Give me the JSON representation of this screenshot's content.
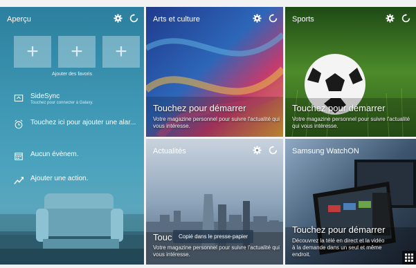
{
  "apercu": {
    "title": "Aperçu",
    "fav_label": "Ajouter des favoris",
    "fav_plus": "+",
    "sidesync_title": "SideSync",
    "sidesync_sub": "Touchez pour connecter à Galaxy.",
    "alarm": "Touchez ici pour ajouter une alar...",
    "event": "Aucun évènem.",
    "action": "Ajouter une action."
  },
  "arts": {
    "title": "Arts et culture",
    "big": "Touchez pour démarrer",
    "sub": "Votre magazine personnel pour suivre l'actualité qui vous intéresse."
  },
  "sports": {
    "title": "Sports",
    "big": "Touchez pour démarrer",
    "sub": "Votre magazine personnel pour suivre l'actualité qui vous intéresse."
  },
  "actu": {
    "title": "Actualités",
    "big": "Touc",
    "sub": "Votre magazine personnel pour suivre l'actualité qui vous intéresse."
  },
  "watchon": {
    "title": "Samsung WatchON",
    "big": "Touchez pour démarrer",
    "sub": "Découvrez la télé en direct et la vidéo à la demande dans un seul et même endroit."
  },
  "toast": "Copié dans le presse-papier",
  "colors": {
    "accent": "#3c95b2"
  }
}
